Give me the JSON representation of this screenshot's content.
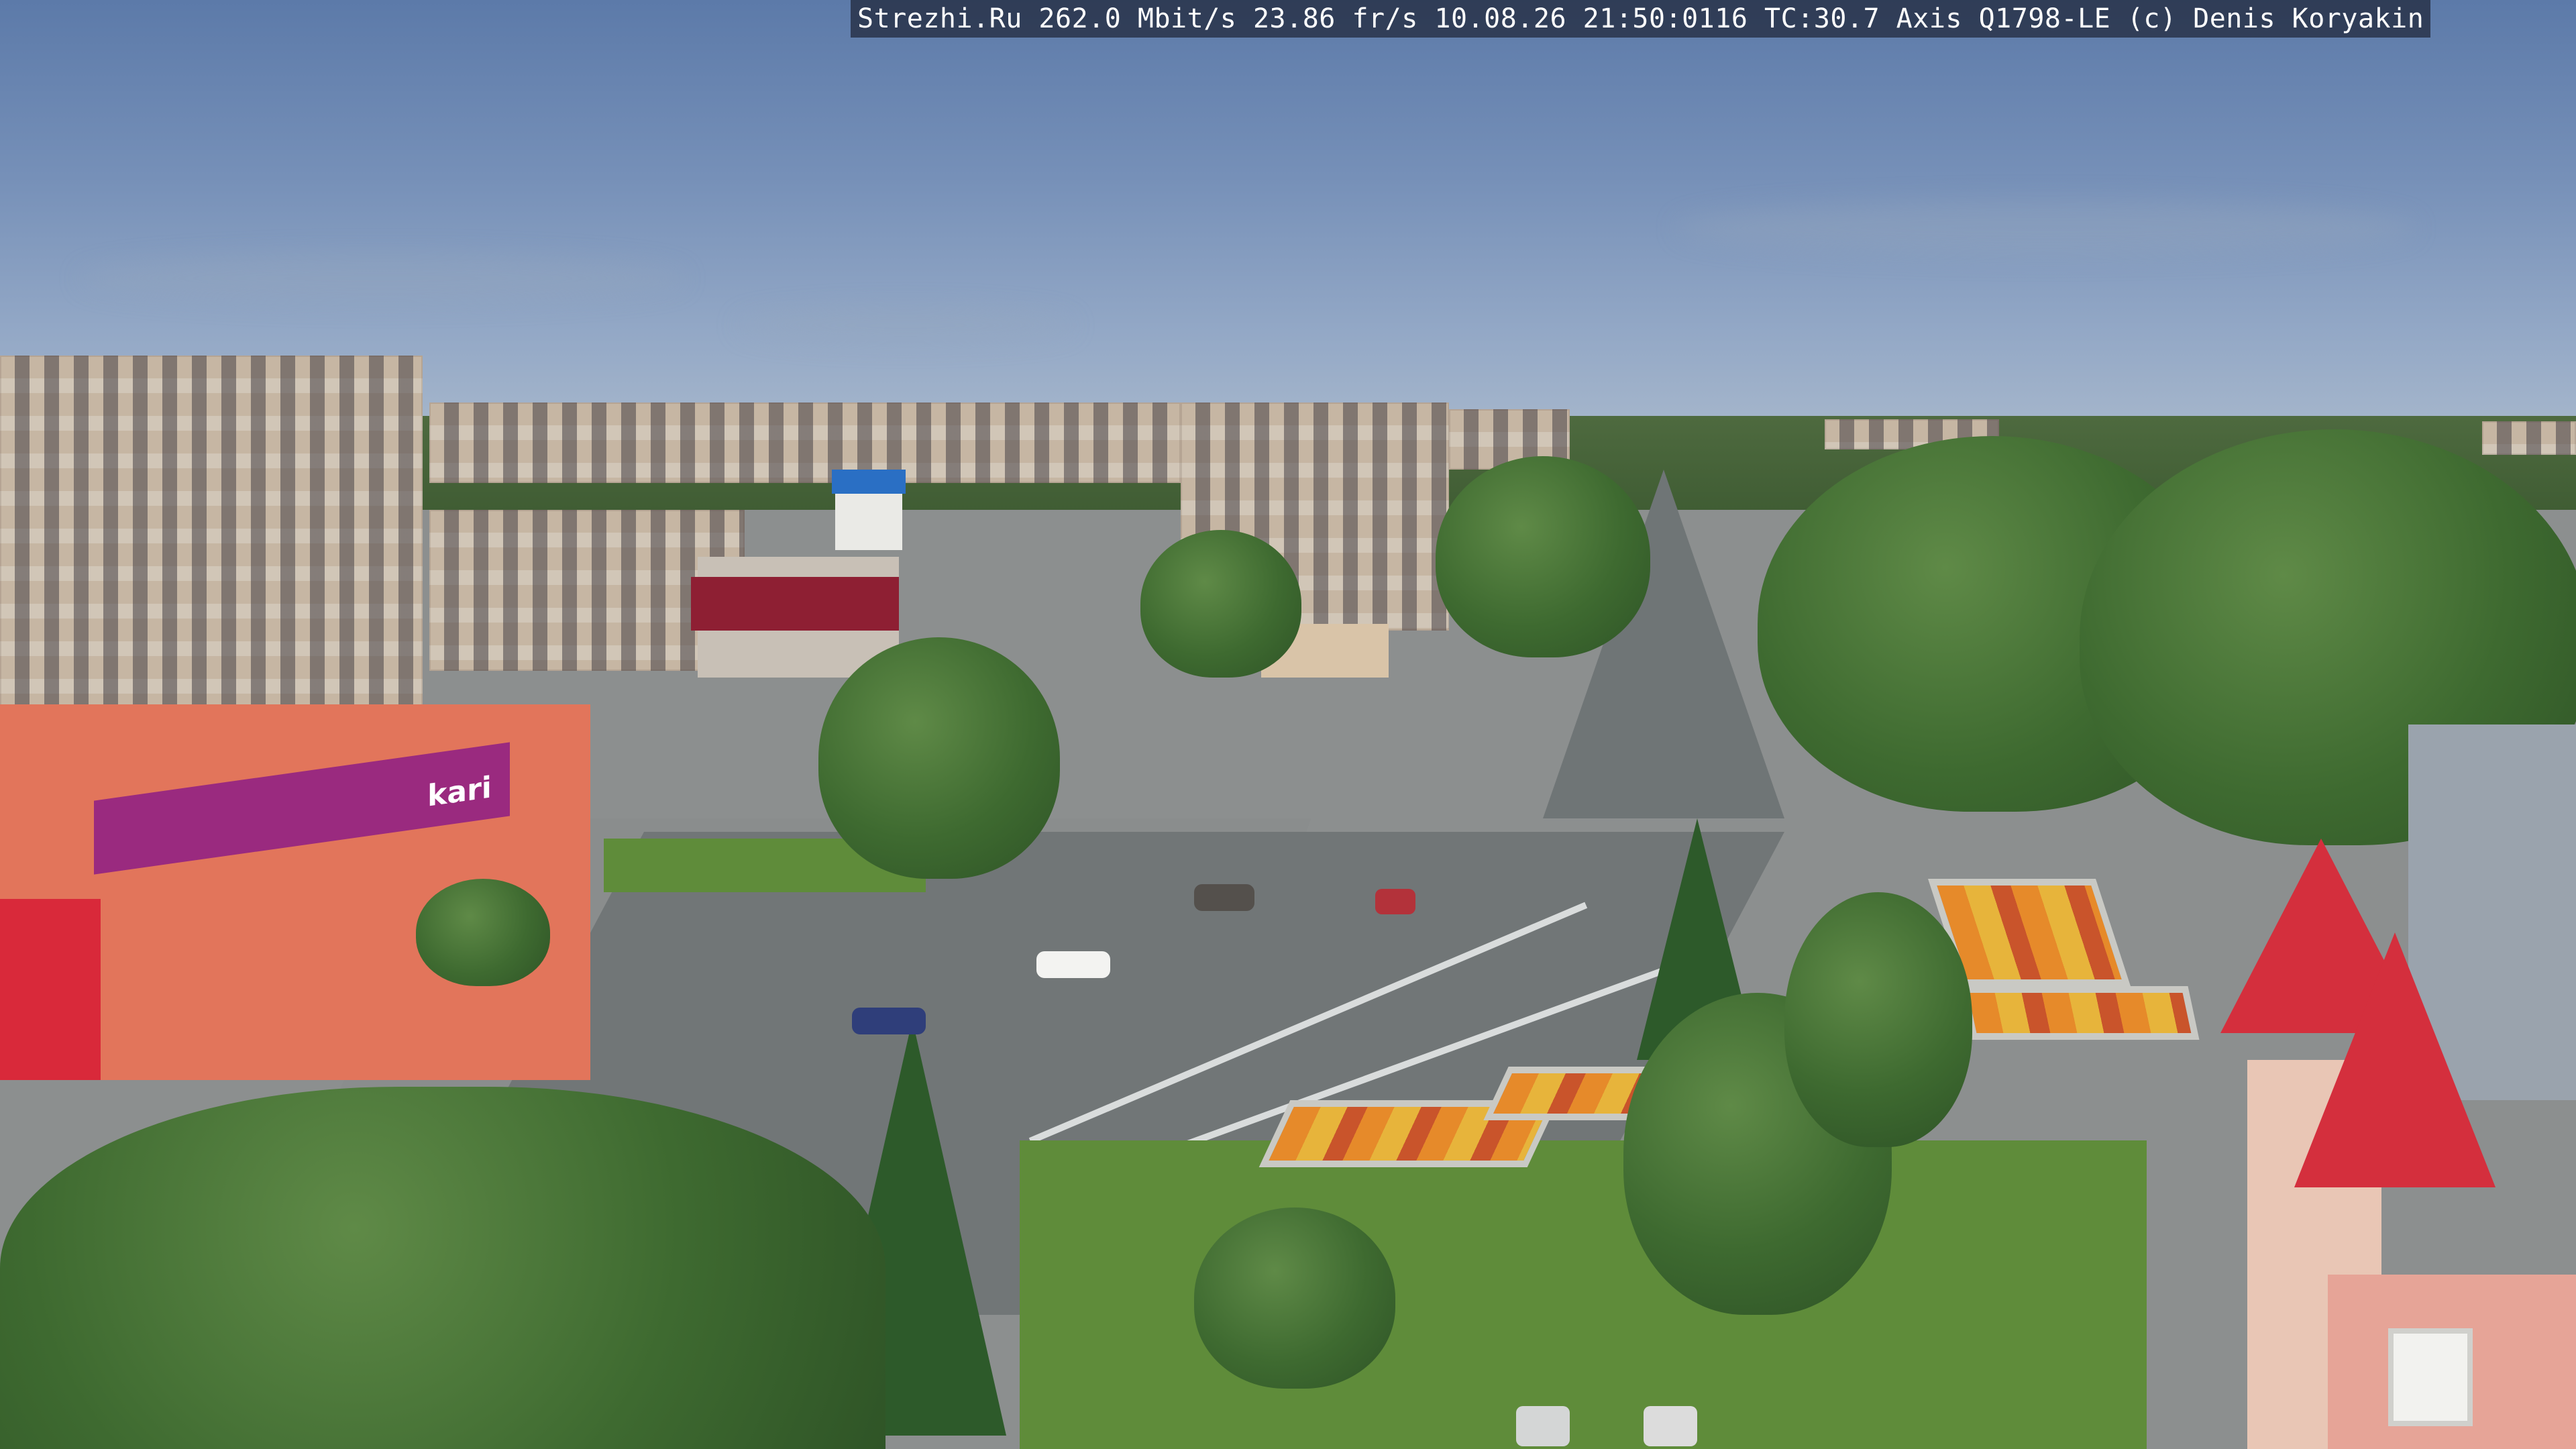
{
  "camera_overlay": {
    "text": "Strezhi.Ru 262.0 Mbit/s 23.86 fr/s 10.08.26 21:50:0116 TC:30.7  Axis Q1798-LE  (c) Denis Koryakin"
  },
  "signage": {
    "shop_logo": "kari"
  },
  "colors": {
    "sky": "#7690b8",
    "foliage": "#3e6a30",
    "road": "#717677",
    "shop_facade": "#e2755b",
    "shop_band": "#9a2a7f",
    "roof_red": "#d42f3d"
  }
}
